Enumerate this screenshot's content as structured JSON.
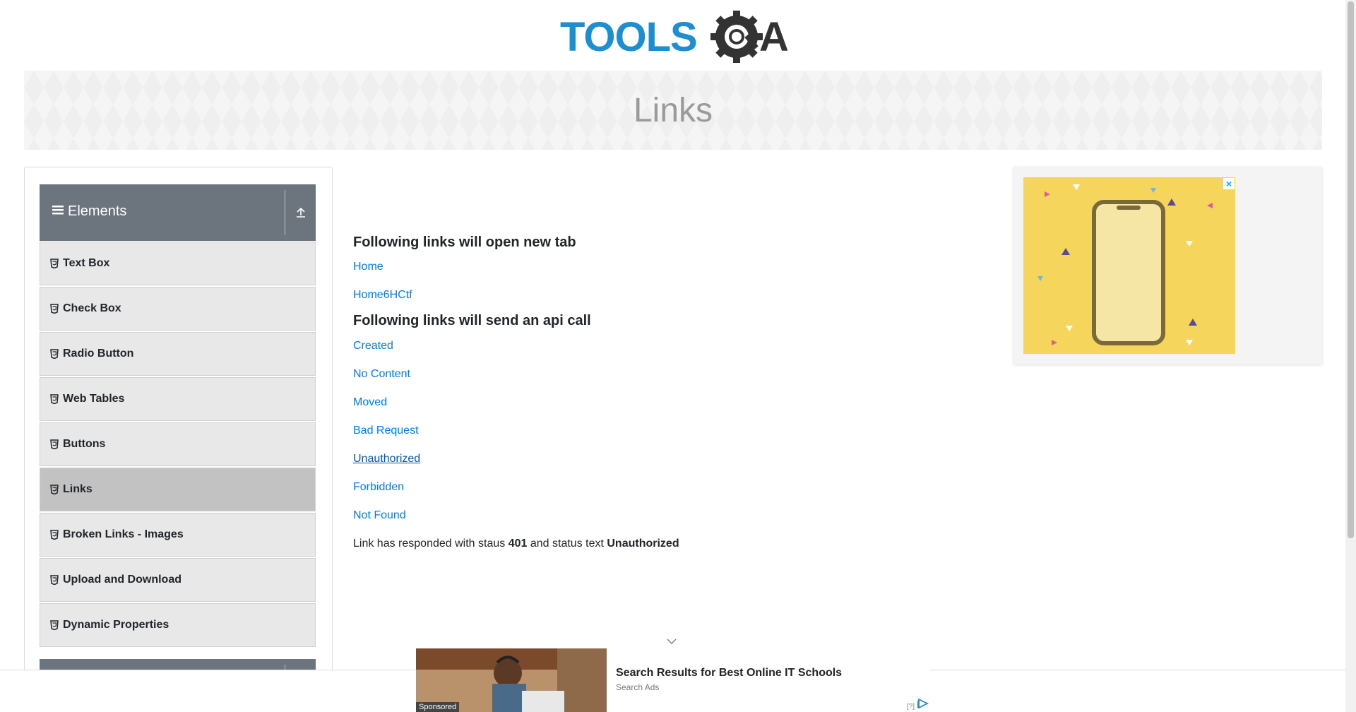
{
  "header": {
    "logo_alt": "TOOLSQA"
  },
  "banner": {
    "title": "Links"
  },
  "sidebar": {
    "group_title": "Elements",
    "items": [
      {
        "label": "Text Box"
      },
      {
        "label": "Check Box"
      },
      {
        "label": "Radio Button"
      },
      {
        "label": "Web Tables"
      },
      {
        "label": "Buttons"
      },
      {
        "label": "Links",
        "active": true
      },
      {
        "label": "Broken Links - Images"
      },
      {
        "label": "Upload and Download"
      },
      {
        "label": "Dynamic Properties"
      }
    ]
  },
  "main": {
    "section1_title": "Following links will open new tab",
    "section1_links": [
      "Home",
      "Home6HCtf"
    ],
    "section2_title": "Following links will send an api call",
    "section2_links": [
      "Created",
      "No Content",
      "Moved",
      "Bad Request",
      "Unauthorized",
      "Forbidden",
      "Not Found"
    ],
    "response": {
      "prefix": "Link has responded with staus",
      "status_code": "401",
      "middle": "and status text",
      "status_text": "Unauthorized"
    }
  },
  "ad_bottom": {
    "title": "Search Results for Best Online IT Schools",
    "subtitle": "Search Ads",
    "sponsored": "Sponsored",
    "help": "[?]"
  },
  "colors": {
    "link": "#007bff",
    "sidebar_header": "#6c757d",
    "logo_blue": "#1d8fd0"
  }
}
